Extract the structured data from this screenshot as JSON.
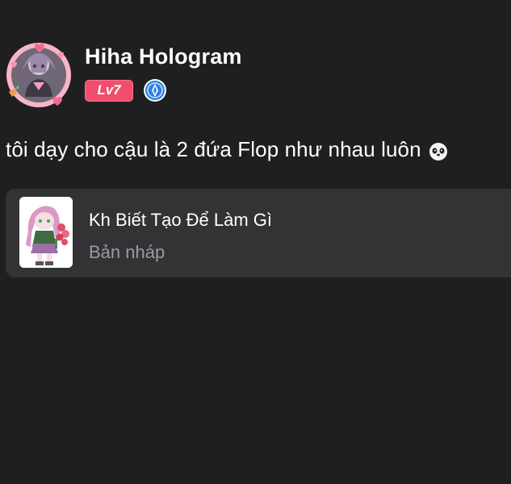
{
  "post": {
    "author": {
      "name": "Hiha Hologram",
      "level": "Lv7",
      "avatar_icon": "pink-frame-anime-character-avatar",
      "verified_icon": "blue-verified-badge-icon",
      "level_color": "#f04e6c"
    },
    "text": "tôi dạy cho cậu là 2 đứa Flop như nhau luôn",
    "trailing_emoji": "panda-face-icon",
    "draft": {
      "title": "Kh Biết Tạo Để Làm Gì",
      "status": "Bản nháp",
      "thumbnail_icon": "pink-haired-chibi-character-with-flowers"
    }
  },
  "colors": {
    "background": "#1f1f21",
    "card": "#333336",
    "muted_text": "#9a9a9e"
  }
}
